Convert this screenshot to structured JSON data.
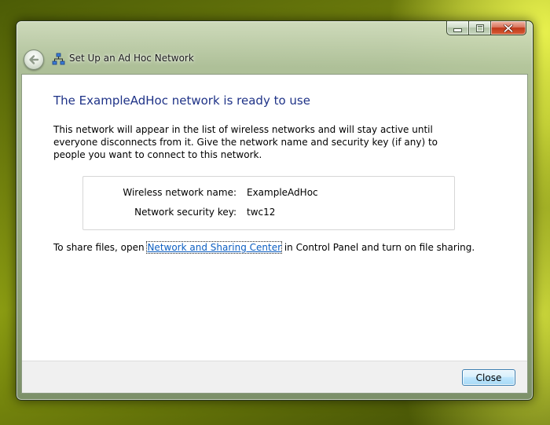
{
  "window": {
    "title": "Set Up an Ad Hoc Network",
    "title_icon": "network-icon",
    "back_icon": "back-arrow-icon",
    "caption_buttons": [
      "minimize",
      "maximize",
      "close"
    ]
  },
  "content": {
    "heading": "The ExampleAdHoc network is ready to use",
    "description": "This network will appear in the list of wireless networks and will stay active until everyone disconnects from it. Give the network name and security key (if any) to people you want to connect to this network.",
    "details": [
      {
        "label": "Wireless network name:",
        "value": "ExampleAdHoc"
      },
      {
        "label": "Network security key:",
        "value": "twc12"
      }
    ],
    "share": {
      "prefix": "To share files, open ",
      "link": "Network and Sharing Center",
      "suffix": " in Control Panel and turn on file sharing."
    }
  },
  "footer": {
    "close_label": "Close"
  },
  "colors": {
    "heading": "#1e3287",
    "link": "#0d5fc2",
    "close_button_border": "#3c7fb1",
    "caption_close": "#c0391a"
  }
}
